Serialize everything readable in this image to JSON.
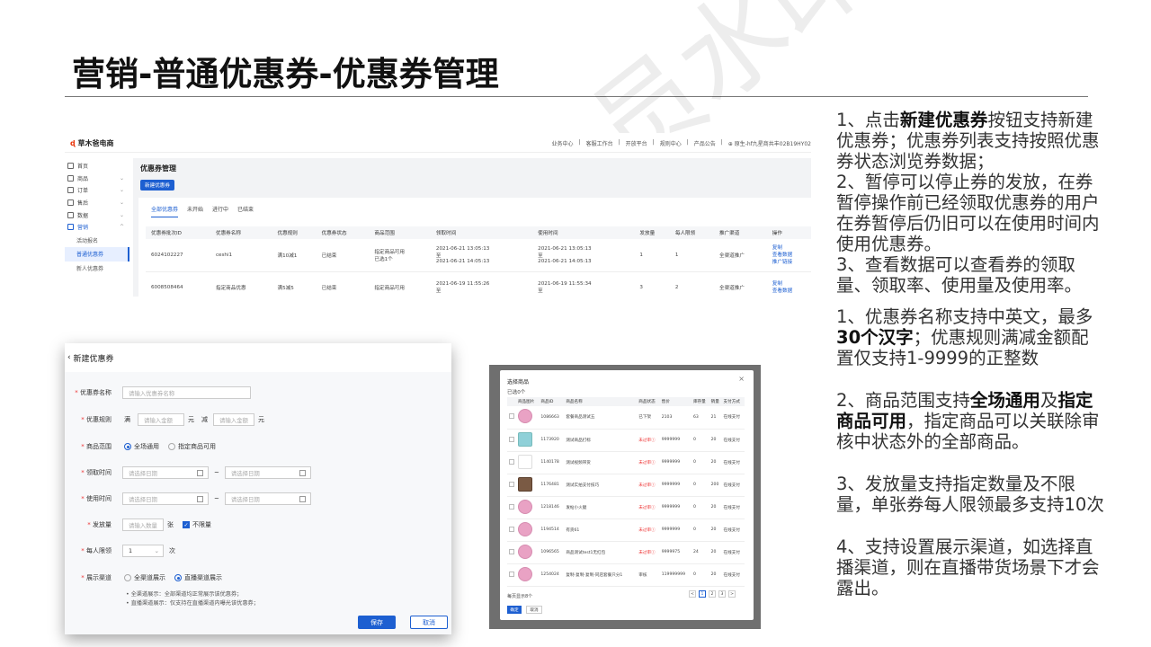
{
  "slide": {
    "title": "营销-普通优惠券-优惠券管理",
    "watermark": "非会员水印"
  },
  "coupon_list": {
    "logo": "草木爸电商",
    "top_nav": [
      "业务中心",
      "客服工作台",
      "开放平台",
      "规则中心",
      "产品公告",
      "⊕ 原生-hf九星商共丰02B19HY02"
    ],
    "sidebar": [
      {
        "label": "首页",
        "icon": "home-icon"
      },
      {
        "label": "商品",
        "icon": "goods-icon"
      },
      {
        "label": "订单",
        "icon": "order-icon"
      },
      {
        "label": "售后",
        "icon": "after-sale-icon"
      },
      {
        "label": "数据",
        "icon": "chart-icon"
      },
      {
        "label": "营销",
        "icon": "marketing-icon"
      }
    ],
    "sidebar_sub": [
      "活动报名",
      "普通优惠券",
      "新人优惠券"
    ],
    "page_title": "优惠券管理",
    "create_button": "新建优惠券",
    "tabs": [
      "全部优惠券",
      "未开始",
      "进行中",
      "已结束"
    ],
    "columns": [
      "优惠券批次ID",
      "优惠券名称",
      "优惠规则",
      "优惠券状态",
      "商品范围",
      "领取时间",
      "使用时间",
      "发放量",
      "每人限领",
      "推广渠道",
      "操作"
    ],
    "rows": [
      {
        "id": "6024102227",
        "name": "ceshi1",
        "rule": "满10减1",
        "status": "已结束",
        "scope": "指定商品可用\n已选1个",
        "receive": "2021-06-21 13:05:13\n至\n2021-06-21 14:05:13",
        "use": "2021-06-21 13:05:13\n至\n2021-06-21 14:05:13",
        "qty": "1",
        "limit": "1",
        "channel": "全渠道推广",
        "ops": [
          "复制",
          "查看数据",
          "推广链接"
        ]
      },
      {
        "id": "6008508464",
        "name": "指定商品优惠",
        "rule": "满5减5",
        "status": "已结束",
        "scope": "指定商品可用",
        "receive": "2021-06-19 11:55:26\n至",
        "use": "2021-06-19 11:55:34\n至",
        "qty": "3",
        "limit": "2",
        "channel": "全渠道推广",
        "ops": [
          "复制",
          "查看数据"
        ]
      }
    ]
  },
  "new_coupon": {
    "title": "新建优惠券",
    "name_label": "优惠券名称",
    "name_placeholder": "请输入优惠券名称",
    "rule_label": "优惠规则",
    "rule_full": "满",
    "rule_amount_placeholder": "请输入金额",
    "rule_unit": "元",
    "rule_minus": "减",
    "rule_minus_placeholder": "请输入金额",
    "rule_unit2": "元",
    "scope_label": "商品范围",
    "scope_options": [
      "全场通用",
      "指定商品可用"
    ],
    "receive_label": "领取时间",
    "use_label": "使用时间",
    "date_placeholder": "请选择日期",
    "date_sep": "~",
    "qty_label": "发放量",
    "qty_placeholder": "请输入数量",
    "qty_unit": "张",
    "unlimited_label": "不限量",
    "limit_label": "每人限领",
    "limit_value": "1",
    "limit_unit": "次",
    "channel_label": "展示渠道",
    "channel_options": [
      "全渠道展示",
      "直播渠道展示"
    ],
    "channel_notes": [
      "• 全渠道展示：全部渠道均正常展示该优惠券；",
      "• 直播渠道展示：仅支持在直播渠道内曝光该优惠券；"
    ],
    "save": "保存",
    "cancel": "取消"
  },
  "product_picker": {
    "title": "选择商品",
    "selected_count": "已选0个",
    "close": "×",
    "columns": [
      "商品图片",
      "商品ID",
      "商品名称",
      "商品状态",
      "售价",
      "库存量",
      "销量",
      "支付方式"
    ],
    "rows": [
      {
        "thumb": "circle",
        "id": "1086663",
        "name": "套餐商品测试五",
        "status": "已下架",
        "status_red": false,
        "price": "2103",
        "stock": "63",
        "sales": "21",
        "pay": "在线支付"
      },
      {
        "thumb": "square",
        "id": "1173920",
        "name": "测试商品打标",
        "status": "未过审ⓘ",
        "status_red": true,
        "price": "9999999",
        "stock": "0",
        "sales": "20",
        "pay": "在线支付"
      },
      {
        "thumb": "line",
        "id": "1140178",
        "name": "测试视频带货",
        "status": "未过审ⓘ",
        "status_red": true,
        "price": "9999999",
        "stock": "0",
        "sales": "20",
        "pay": "在线支付"
      },
      {
        "thumb": "photo",
        "id": "1176481",
        "name": "测试实拍支付技巧",
        "status": "未过审ⓘ",
        "status_red": true,
        "price": "9999999",
        "stock": "0",
        "sales": "200",
        "pay": "在线支付"
      },
      {
        "thumb": "circle",
        "id": "1218146",
        "name": "发帖小火腿",
        "status": "未过审ⓘ",
        "status_red": true,
        "price": "9999999",
        "stock": "0",
        "sales": "20",
        "pay": "在线支付"
      },
      {
        "thumb": "circle",
        "id": "1194514",
        "name": "有货61",
        "status": "未过审ⓘ",
        "status_red": true,
        "price": "9999999",
        "stock": "0",
        "sales": "20",
        "pay": "在线支付"
      },
      {
        "thumb": "circle",
        "id": "1096565",
        "name": "商品测试test1无红包",
        "status": "未过审ⓘ",
        "status_red": true,
        "price": "9999975",
        "stock": "24",
        "sales": "20",
        "pay": "在线支付"
      },
      {
        "thumb": "circle",
        "id": "1254024",
        "name": "复制-复制-复制-同店套餐只分1",
        "status": "审核",
        "status_red": false,
        "price": "119999999",
        "stock": "0",
        "sales": "20",
        "pay": "在线支付"
      }
    ],
    "footer": "每页显示8个",
    "pages": [
      "<",
      "1",
      "2",
      "3",
      ">"
    ],
    "ok": "确定",
    "cancel": "取消"
  },
  "notes_top": [
    {
      "pre": "1、点击",
      "bold": "新建优惠券",
      "post": "按钮支持新建优惠券；优惠券列表支持按照优惠券状态浏览券数据；"
    },
    {
      "pre": "2、暂停可以停止券的发放，在券暂停操作前已经领取优惠券的用户在券暂停后仍旧可以在使用时间内使用优惠券。",
      "bold": "",
      "post": ""
    },
    {
      "pre": "3、查看数据可以查看券的领取量、领取率、使用量及使用率。",
      "bold": "",
      "post": ""
    }
  ],
  "notes_bottom": [
    {
      "pre": "1、优惠券名称支持中英文，最多",
      "bold": "30个汉字",
      "post": "；优惠规则满减金额配置仅支持1-9999的正整数"
    },
    {
      "pre": "2、商品范围支持",
      "bold": "全场通用",
      "mid": "及",
      "bold2": "指定商品可用",
      "post": "，指定商品可以关联除审核中状态外的全部商品。"
    },
    {
      "pre": "3、发放量支持指定数量及不限量，单张券每人限领最多支持10次",
      "bold": "",
      "post": ""
    },
    {
      "pre": "4、支持设置展示渠道，如选择直播渠道，则在直播带货场景下才会露出。",
      "bold": "",
      "post": ""
    }
  ]
}
